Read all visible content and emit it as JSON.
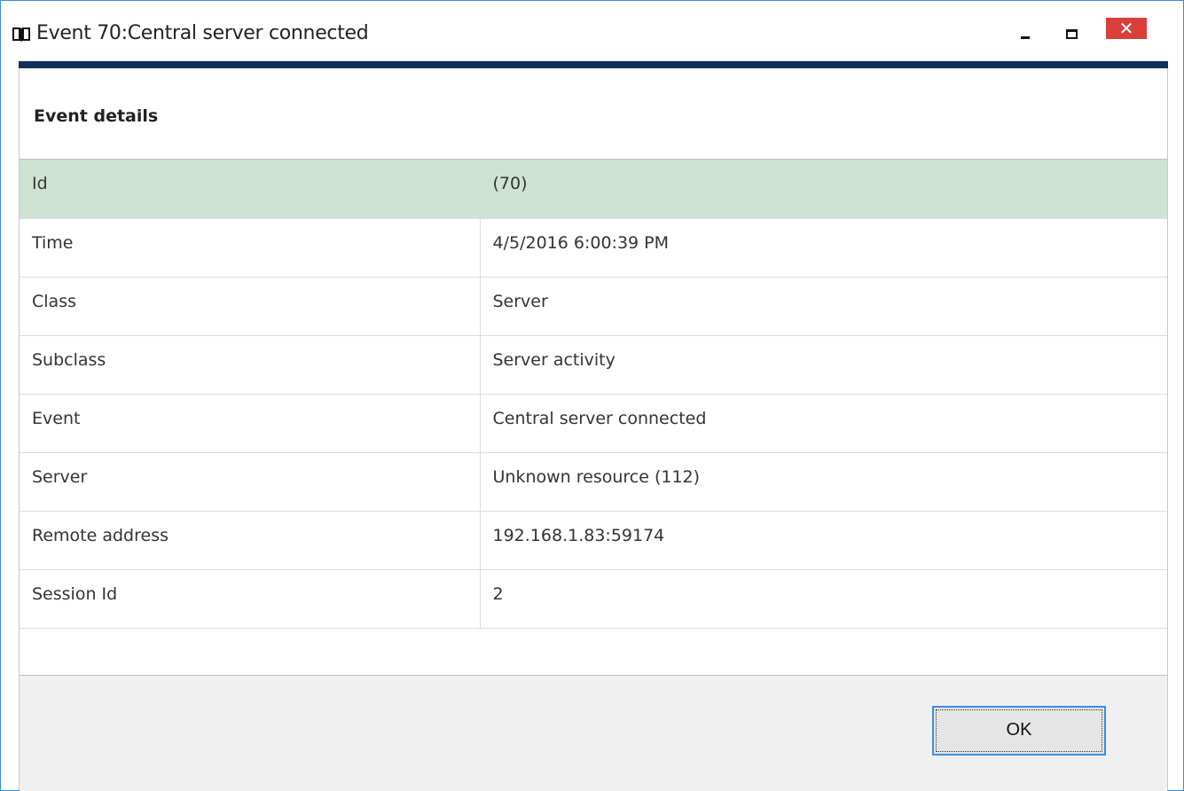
{
  "window": {
    "title": "Event 70:Central server connected",
    "icon": "book-icon",
    "controls": {
      "minimize_icon": "minimize-icon",
      "maximize_icon": "maximize-icon",
      "close_label": "✕"
    },
    "accent_color": "#12305c",
    "close_color": "#d9403a"
  },
  "section": {
    "title": "Event details"
  },
  "details": {
    "selected_row_color": "#cfe3d5",
    "rows": [
      {
        "key": "Id",
        "value": "(70)"
      },
      {
        "key": "Time",
        "value": "4/5/2016 6:00:39 PM"
      },
      {
        "key": "Class",
        "value": "Server"
      },
      {
        "key": "Subclass",
        "value": "Server activity"
      },
      {
        "key": "Event",
        "value": "Central server connected"
      },
      {
        "key": "Server",
        "value": "Unknown resource (112)"
      },
      {
        "key": "Remote address",
        "value": "192.168.1.83:59174"
      },
      {
        "key": "Session Id",
        "value": "2"
      }
    ]
  },
  "footer": {
    "ok_label": "OK"
  }
}
